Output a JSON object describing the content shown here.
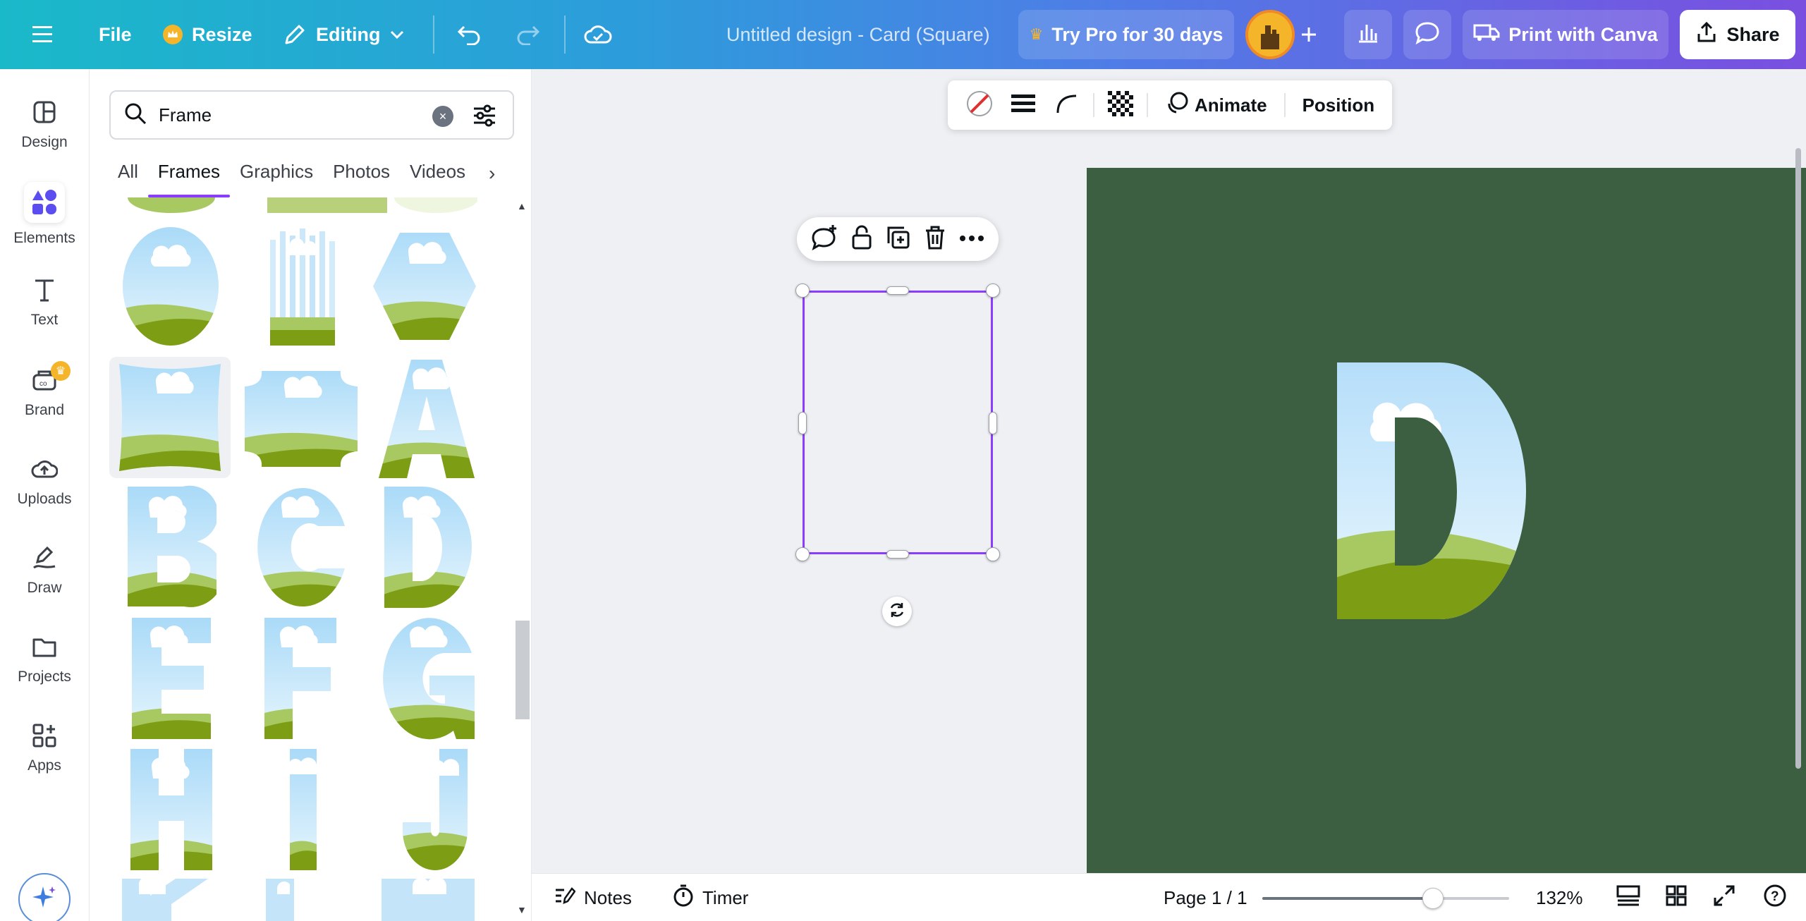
{
  "topbar": {
    "file_label": "File",
    "resize_label": "Resize",
    "mode_label": "Editing",
    "doc_title": "Untitled design - Card (Square)",
    "try_pro_label": "Try Pro for 30 days",
    "print_label": "Print with Canva",
    "share_label": "Share"
  },
  "rail": {
    "items": [
      {
        "label": "Design",
        "icon": "design-icon"
      },
      {
        "label": "Elements",
        "icon": "elements-icon",
        "active": true
      },
      {
        "label": "Text",
        "icon": "text-icon"
      },
      {
        "label": "Brand",
        "icon": "brand-icon",
        "badge": "crown"
      },
      {
        "label": "Uploads",
        "icon": "uploads-icon"
      },
      {
        "label": "Draw",
        "icon": "draw-icon"
      },
      {
        "label": "Projects",
        "icon": "projects-icon"
      },
      {
        "label": "Apps",
        "icon": "apps-icon"
      }
    ]
  },
  "panel": {
    "search_value": "Frame",
    "tabs": [
      "All",
      "Frames",
      "Graphics",
      "Photos",
      "Videos"
    ],
    "active_tab": "Frames",
    "frame_letters": [
      "A",
      "B",
      "C",
      "D",
      "E",
      "F",
      "G",
      "H",
      "I",
      "J",
      "K",
      "L",
      "M"
    ]
  },
  "context_toolbar": {
    "animate_label": "Animate",
    "position_label": "Position"
  },
  "canvas": {
    "page_color": "#3b5f40",
    "selected_element_letter": "D"
  },
  "bottombar": {
    "notes_label": "Notes",
    "timer_label": "Timer",
    "page_indicator": "Page 1 / 1",
    "zoom_label": "132%",
    "zoom_fraction": 0.69
  },
  "colors": {
    "accent": "#8b3dff",
    "sky_top": "#bfe4fb",
    "hill_light": "#a8c862",
    "hill_dark": "#7d9e14"
  }
}
